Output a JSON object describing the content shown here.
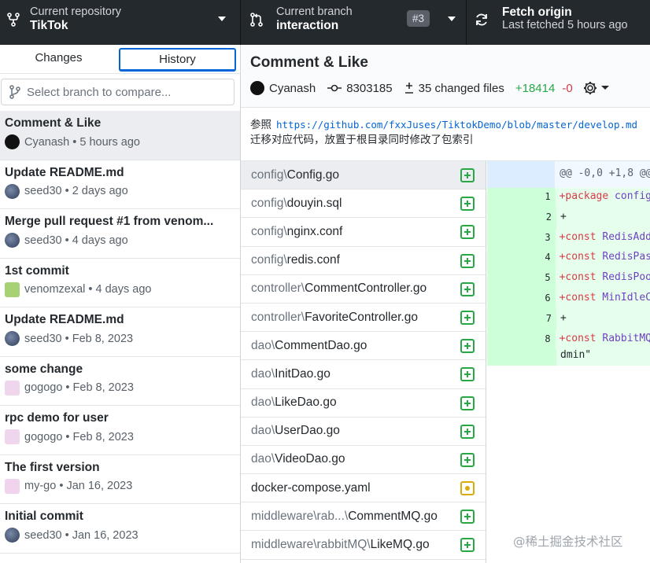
{
  "toolbar": {
    "repo": {
      "label": "Current repository",
      "value": "TikTok"
    },
    "branch": {
      "label": "Current branch",
      "value": "interaction",
      "pr_badge": "#3"
    },
    "fetch": {
      "label": "Fetch origin",
      "value": "Last fetched 5 hours ago"
    }
  },
  "tabs": {
    "changes": "Changes",
    "history": "History",
    "active": "History"
  },
  "branch_compare": {
    "placeholder": "Select branch to compare..."
  },
  "commits": [
    {
      "title": "Comment & Like",
      "author": "Cyanash",
      "time": "5 hours ago",
      "selected": true
    },
    {
      "title": "Update README.md",
      "author": "seed30",
      "time": "2 days ago"
    },
    {
      "title": "Merge pull request #1 from venom...",
      "author": "seed30",
      "time": "4 days ago"
    },
    {
      "title": "1st commit",
      "author": "venomzexal",
      "time": "4 days ago"
    },
    {
      "title": "Update README.md",
      "author": "seed30",
      "time": "Feb 8, 2023"
    },
    {
      "title": "some change",
      "author": "gogogo",
      "time": "Feb 8, 2023"
    },
    {
      "title": "rpc demo for user",
      "author": "gogogo",
      "time": "Feb 8, 2023"
    },
    {
      "title": "The first version",
      "author": "my-go",
      "time": "Jan 16, 2023"
    },
    {
      "title": "Initial commit",
      "author": "seed30",
      "time": "Jan 16, 2023"
    }
  ],
  "commit_detail": {
    "title": "Comment & Like",
    "author": "Cyanash",
    "sha": "8303185",
    "changed_files": "35 changed files",
    "additions": "+18414",
    "deletions": "-0",
    "description_prefix": "参照",
    "description_link": "https://github.com/fxxJuses/TiktokDemo/blob/master/develop.md",
    "description_line2": "迁移对应代码，放置于根目录同时修改了包索引"
  },
  "files": [
    {
      "dir": "config\\",
      "name": "Config.go",
      "status": "added",
      "selected": true
    },
    {
      "dir": "config\\",
      "name": "douyin.sql",
      "status": "added"
    },
    {
      "dir": "config\\",
      "name": "nginx.conf",
      "status": "added"
    },
    {
      "dir": "config\\",
      "name": "redis.conf",
      "status": "added"
    },
    {
      "dir": "controller\\",
      "name": "CommentController.go",
      "status": "added"
    },
    {
      "dir": "controller\\",
      "name": "FavoriteController.go",
      "status": "added"
    },
    {
      "dir": "dao\\",
      "name": "CommentDao.go",
      "status": "added"
    },
    {
      "dir": "dao\\",
      "name": "InitDao.go",
      "status": "added"
    },
    {
      "dir": "dao\\",
      "name": "LikeDao.go",
      "status": "added"
    },
    {
      "dir": "dao\\",
      "name": "UserDao.go",
      "status": "added"
    },
    {
      "dir": "dao\\",
      "name": "VideoDao.go",
      "status": "added"
    },
    {
      "dir": "",
      "name": "docker-compose.yaml",
      "status": "modified"
    },
    {
      "dir": "middleware\\rab...\\",
      "name": "CommentMQ.go",
      "status": "added"
    },
    {
      "dir": "middleware\\rabbitMQ\\",
      "name": "LikeMQ.go",
      "status": "added"
    }
  ],
  "diff": {
    "hunk": "@@ -0,0 +1,8 @@",
    "lines": [
      {
        "n": "1",
        "kw": "+package",
        "rest": " config"
      },
      {
        "n": "2",
        "kw": "+",
        "rest": ""
      },
      {
        "n": "3",
        "kw": "+const",
        "rest": " RedisAdd"
      },
      {
        "n": "4",
        "kw": "+const",
        "rest": " RedisPas"
      },
      {
        "n": "5",
        "kw": "+const",
        "rest": " RedisPoo"
      },
      {
        "n": "6",
        "kw": "+const",
        "rest": " MinIdleC"
      },
      {
        "n": "7",
        "kw": "+",
        "rest": ""
      },
      {
        "n": "8",
        "kw": "+const",
        "rest": " RabbitMQ"
      }
    ],
    "continuation": "dmin\""
  },
  "watermark": "@稀土掘金技术社区"
}
